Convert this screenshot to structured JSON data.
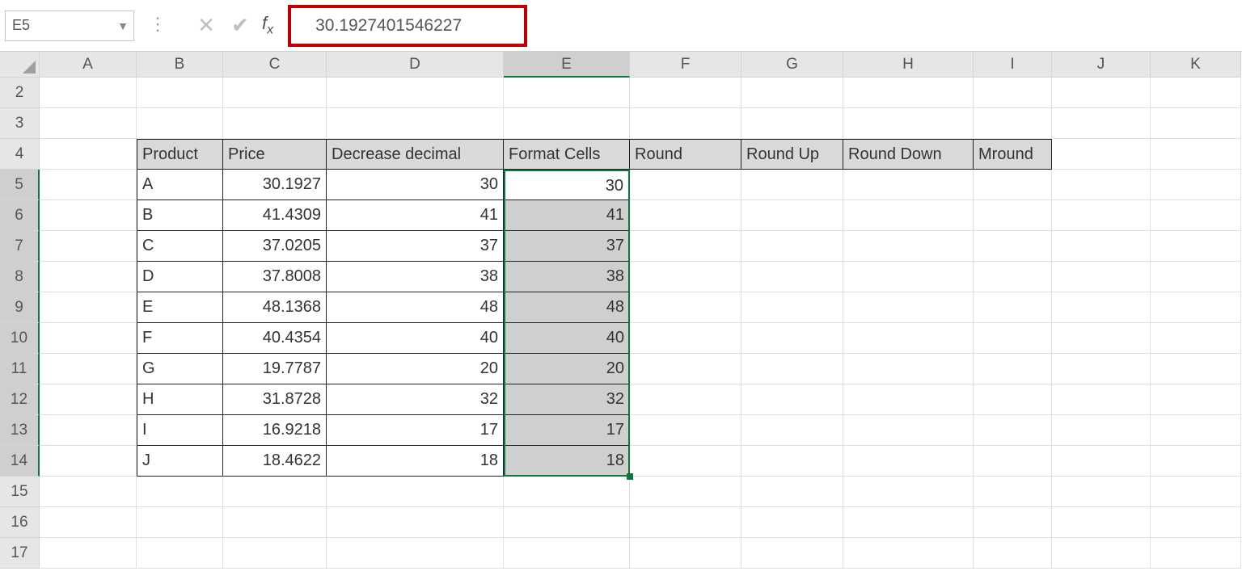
{
  "nameBox": "E5",
  "formulaValue": "30.1927401546227",
  "columns": [
    "A",
    "B",
    "C",
    "D",
    "E",
    "F",
    "G",
    "H",
    "I",
    "J",
    "K"
  ],
  "selectedColumn": "E",
  "rows": [
    "2",
    "3",
    "4",
    "5",
    "6",
    "7",
    "8",
    "9",
    "10",
    "11",
    "12",
    "13",
    "14",
    "15",
    "16",
    "17"
  ],
  "selectedRows": [
    "5",
    "6",
    "7",
    "8",
    "9",
    "10",
    "11",
    "12",
    "13",
    "14"
  ],
  "headers": {
    "product": "Product",
    "price": "Price",
    "decrease": "Decrease decimal",
    "format": "Format Cells",
    "round": "Round",
    "roundup": "Round Up",
    "rounddown": "Round Down",
    "mround": "Mround"
  },
  "data": [
    {
      "product": "A",
      "price": "30.1927",
      "decrease": "30",
      "format": "30"
    },
    {
      "product": "B",
      "price": "41.4309",
      "decrease": "41",
      "format": "41"
    },
    {
      "product": "C",
      "price": "37.0205",
      "decrease": "37",
      "format": "37"
    },
    {
      "product": "D",
      "price": "37.8008",
      "decrease": "38",
      "format": "38"
    },
    {
      "product": "E",
      "price": "48.1368",
      "decrease": "48",
      "format": "48"
    },
    {
      "product": "F",
      "price": "40.4354",
      "decrease": "40",
      "format": "40"
    },
    {
      "product": "G",
      "price": "19.7787",
      "decrease": "20",
      "format": "20"
    },
    {
      "product": "H",
      "price": "31.8728",
      "decrease": "32",
      "format": "32"
    },
    {
      "product": "I",
      "price": "16.9218",
      "decrease": "17",
      "format": "17"
    },
    {
      "product": "J",
      "price": "18.4622",
      "decrease": "18",
      "format": "18"
    }
  ],
  "activeCellValue": "30"
}
